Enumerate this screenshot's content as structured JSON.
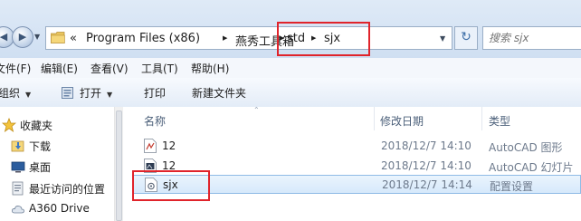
{
  "address_bar": {
    "breadcrumbs": [
      {
        "label": "«"
      },
      {
        "label": "Program Files (x86)"
      },
      {
        "label": "燕秀工具箱"
      },
      {
        "label": "std"
      },
      {
        "label": "sjx"
      }
    ],
    "search_placeholder": "搜索 sjx"
  },
  "menu": {
    "items": [
      {
        "label": "文件(F)"
      },
      {
        "label": "编辑(E)"
      },
      {
        "label": "查看(V)"
      },
      {
        "label": "工具(T)"
      },
      {
        "label": "帮助(H)"
      }
    ]
  },
  "toolbar": {
    "organize": "组织",
    "open": "打开",
    "print": "打印",
    "new_folder": "新建文件夹"
  },
  "nav_pane": {
    "items": [
      {
        "label": "收藏夹",
        "icon": "star-icon"
      },
      {
        "label": "下载",
        "icon": "download-folder-icon"
      },
      {
        "label": "桌面",
        "icon": "desktop-icon"
      },
      {
        "label": "最近访问的位置",
        "icon": "recent-places-icon"
      },
      {
        "label": "A360 Drive",
        "icon": "cloud-drive-icon"
      }
    ]
  },
  "file_list": {
    "columns": {
      "name": "名称",
      "date": "修改日期",
      "type": "类型"
    },
    "rows": [
      {
        "name": "12",
        "date": "2018/12/7 14:10",
        "type": "AutoCAD 图形",
        "icon": "dwg-file-icon",
        "selected": false
      },
      {
        "name": "12",
        "date": "2018/12/7 14:10",
        "type": "AutoCAD 幻灯片",
        "icon": "sld-file-icon",
        "selected": false
      },
      {
        "name": "sjx",
        "date": "2018/12/7 14:14",
        "type": "配置设置",
        "icon": "ini-file-icon",
        "selected": true
      }
    ]
  },
  "colors": {
    "annotation_red": "#e0242b",
    "selection_border": "#8fbbe6",
    "address_bar_bg": "#dfeaf7"
  }
}
